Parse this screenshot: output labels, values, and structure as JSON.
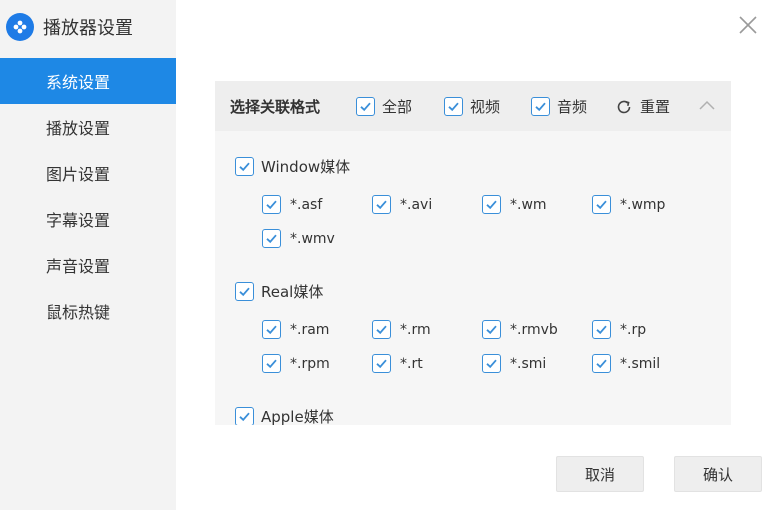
{
  "app": {
    "title": "播放器设置"
  },
  "sidebar": {
    "items": [
      {
        "label": "系统设置",
        "active": true
      },
      {
        "label": "播放设置"
      },
      {
        "label": "图片设置"
      },
      {
        "label": "字幕设置"
      },
      {
        "label": "声音设置"
      },
      {
        "label": "鼠标热键"
      }
    ]
  },
  "panel": {
    "title": "选择关联格式",
    "filters": [
      {
        "label": "全部",
        "checked": true
      },
      {
        "label": "视频",
        "checked": true
      },
      {
        "label": "音频",
        "checked": true
      }
    ],
    "reset_label": "重置",
    "groups": [
      {
        "label": "Window媒体",
        "checked": true,
        "exts": [
          "*.asf",
          "*.avi",
          "*.wm",
          "*.wmp",
          "*.wmv"
        ]
      },
      {
        "label": "Real媒体",
        "checked": true,
        "exts": [
          "*.ram",
          "*.rm",
          "*.rmvb",
          "*.rp",
          "*.rpm",
          "*.rt",
          "*.smi",
          "*.smil"
        ]
      },
      {
        "label": "Apple媒体",
        "checked": true,
        "exts": []
      }
    ]
  },
  "buttons": {
    "cancel": "取消",
    "confirm": "确认"
  },
  "colors": {
    "accent": "#1e88e5",
    "checkbox": "#3a8fd9",
    "sidebar_bg": "#f3f3f3"
  },
  "icons": {
    "logo": "player-logo-icon",
    "close": "close-icon",
    "reset": "refresh-icon",
    "collapse": "chevron-up-icon",
    "checkbox": "checkmark-icon"
  }
}
